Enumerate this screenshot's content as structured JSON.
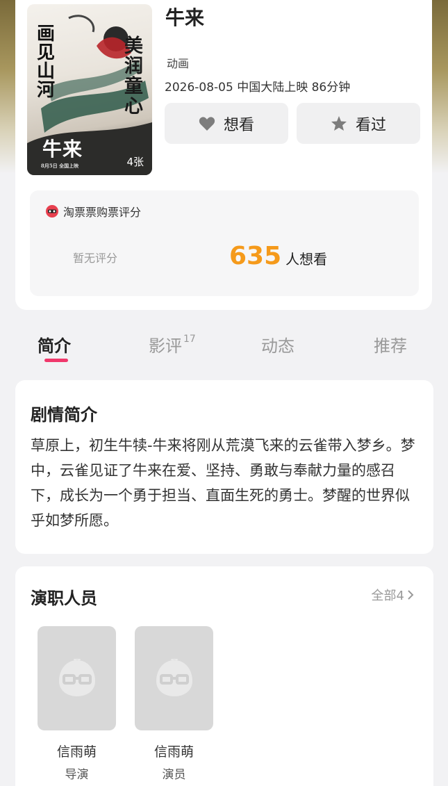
{
  "movie": {
    "title": "牛来",
    "genre": "动画",
    "release_info": "2026-08-05 中国大陆上映 86分钟",
    "poster": {
      "left_text": "画见山河",
      "right_text": "美润童心",
      "title": "牛来",
      "date_line": "8月5日 全国上映",
      "image_count": "4张"
    }
  },
  "actions": {
    "want_label": "想看",
    "seen_label": "看过"
  },
  "rating": {
    "source_label": "淘票票购票评分",
    "no_score_label": "暂无评分",
    "want_count": "635",
    "want_suffix": "人想看"
  },
  "tabs": [
    {
      "label": "简介",
      "badge": ""
    },
    {
      "label": "影评",
      "badge": "17"
    },
    {
      "label": "动态",
      "badge": ""
    },
    {
      "label": "推荐",
      "badge": ""
    }
  ],
  "synopsis": {
    "title": "剧情简介",
    "text": "草原上，初生牛犊-牛来将刚从荒漠飞来的云雀带入梦乡。梦中，云雀见证了牛来在爱、坚持、勇敢与奉献力量的感召下，成长为一个勇于担当、直面生死的勇士。梦醒的世界似乎如梦所愿。"
  },
  "cast": {
    "title": "演职人员",
    "see_all": "全部4",
    "members": [
      {
        "name": "信雨萌",
        "role": "导演"
      },
      {
        "name": "信雨萌",
        "role": "演员"
      }
    ]
  },
  "colors": {
    "accent_orange": "#f59a1b",
    "tab_underline": "#f0386b"
  }
}
